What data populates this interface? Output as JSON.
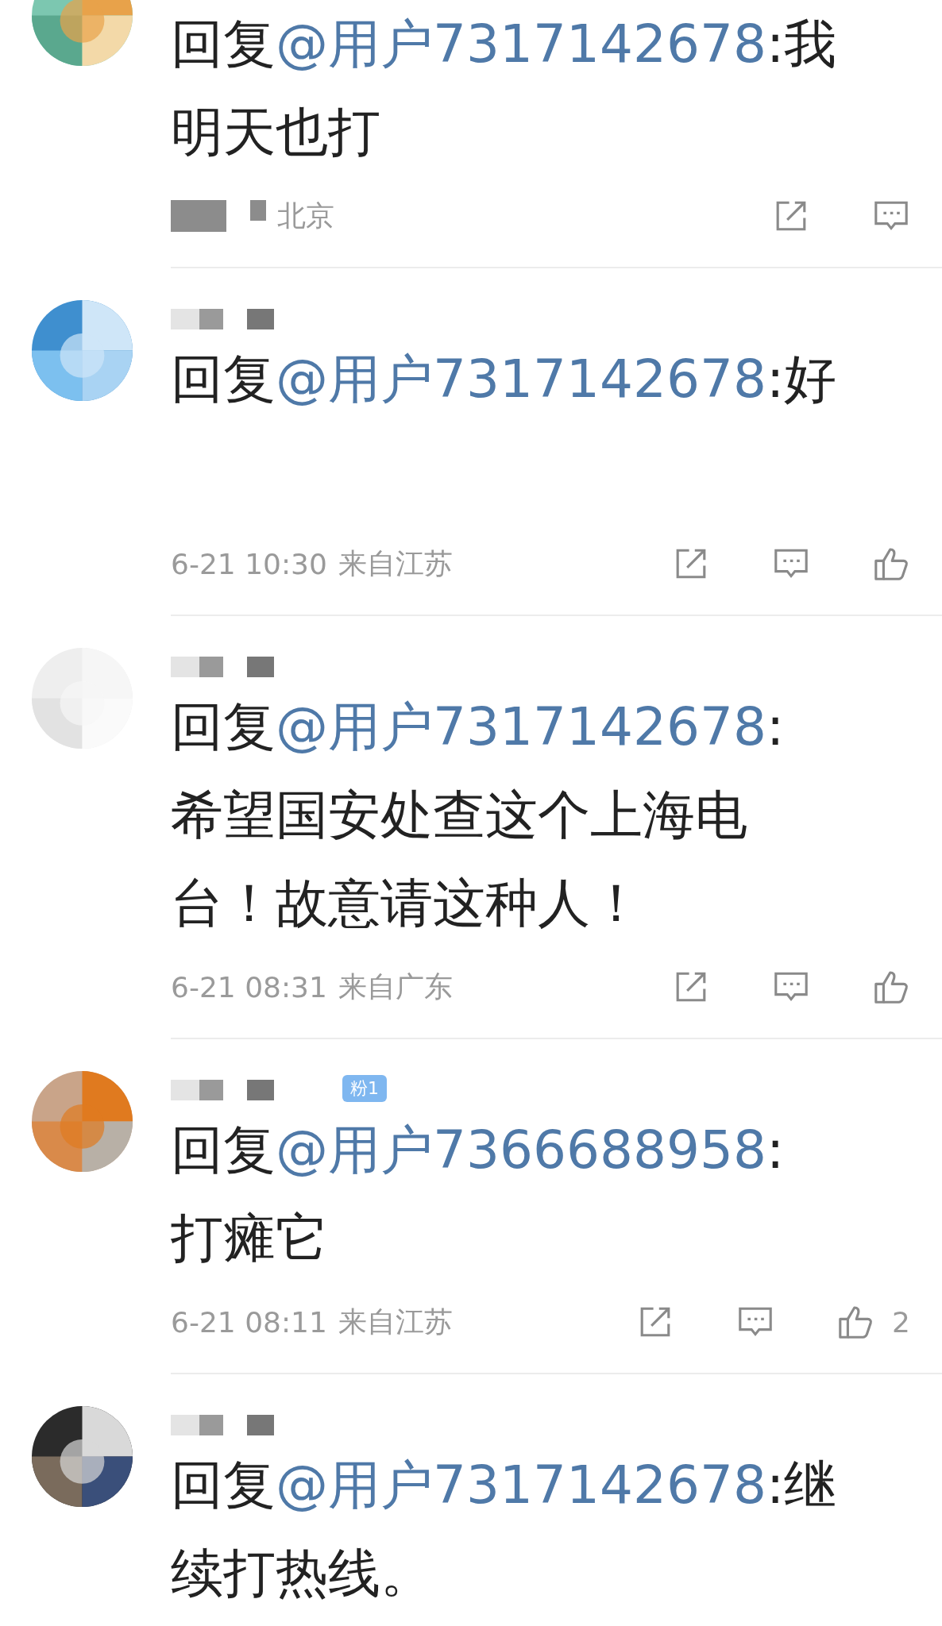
{
  "comments": [
    {
      "prefix": "回复",
      "mention": "@用户7317142678",
      "text": ":我",
      "lines": [
        "明天也打"
      ],
      "location": "北京",
      "like": false
    },
    {
      "name_hidden": true,
      "prefix": "回复",
      "mention": "@用户7317142678",
      "text": ":好",
      "blank_below": true,
      "time": "6-21 10:30",
      "location": "来自江苏",
      "like": true
    },
    {
      "name_hidden": true,
      "prefix": "回复",
      "mention": "@用户7317142678",
      "text": ":",
      "lines": [
        "希望国安处查这个上海电",
        "台！故意请这种人！"
      ],
      "time": "6-21 08:31",
      "location": "来自广东",
      "like": true
    },
    {
      "name_hidden": true,
      "badge": "粉1",
      "prefix": "回复",
      "mention": "@用户7366688958",
      "text": ":",
      "lines": [
        "打瘫它"
      ],
      "time": "6-21 08:11",
      "location": "来自江苏",
      "like": true,
      "like_count": "2"
    },
    {
      "name_hidden": true,
      "prefix": "回复",
      "mention": "@用户7317142678",
      "text": ":继",
      "lines": [
        "续打热线。"
      ]
    }
  ]
}
